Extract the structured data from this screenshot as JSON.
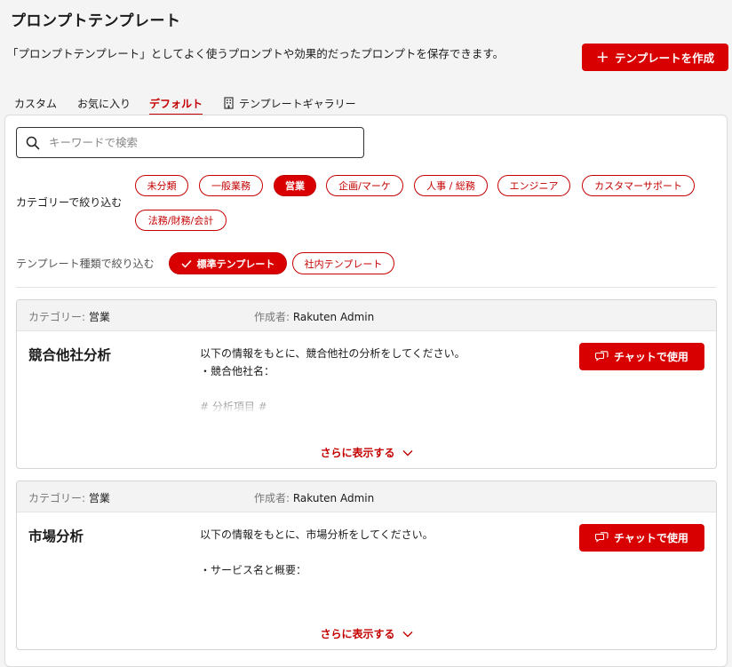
{
  "page": {
    "title": "プロンプトテンプレート",
    "description": "「プロンプトテンプレート」としてよく使うプロンプトや効果的だったプロンプトを保存できます。",
    "create_button": "テンプレートを作成"
  },
  "tabs": [
    {
      "label": "カスタム",
      "active": false
    },
    {
      "label": "お気に入り",
      "active": false
    },
    {
      "label": "デフォルト",
      "active": true
    },
    {
      "label": "テンプレートギャラリー",
      "active": false,
      "icon": "building-icon"
    }
  ],
  "search": {
    "placeholder": "キーワードで検索",
    "value": ""
  },
  "category_filter": {
    "label": "カテゴリーで絞り込む",
    "chips": [
      {
        "label": "未分類",
        "selected": false
      },
      {
        "label": "一般業務",
        "selected": false
      },
      {
        "label": "営業",
        "selected": true
      },
      {
        "label": "企画/マーケ",
        "selected": false
      },
      {
        "label": "人事 / 総務",
        "selected": false
      },
      {
        "label": "エンジニア",
        "selected": false
      },
      {
        "label": "カスタマーサポート",
        "selected": false
      },
      {
        "label": "法務/財務/会計",
        "selected": false
      }
    ]
  },
  "type_filter": {
    "label": "テンプレート種類で絞り込む",
    "chips": [
      {
        "label": "標準テンプレート",
        "selected": true
      },
      {
        "label": "社内テンプレート",
        "selected": false
      }
    ]
  },
  "card_labels": {
    "category_key": "カテゴリー: ",
    "author_key": "作成者: ",
    "use_button": "チャットで使用",
    "show_more": "さらに表示する"
  },
  "templates": [
    {
      "category": "営業",
      "author": "Rakuten Admin",
      "title": "競合他社分析",
      "body": "以下の情報をもとに、競合他社の分析をしてください。\n・競合他社名：\n\n# 分析項目 #\n・強み\n・弱み"
    },
    {
      "category": "営業",
      "author": "Rakuten Admin",
      "title": "市場分析",
      "body": "以下の情報をもとに、市場分析をしてください。\n\n・サービス名と概要：\n\n# 分析項目 #\n・市場規模"
    }
  ],
  "colors": {
    "accent": "#d80000",
    "background": "#f4f4f4"
  }
}
